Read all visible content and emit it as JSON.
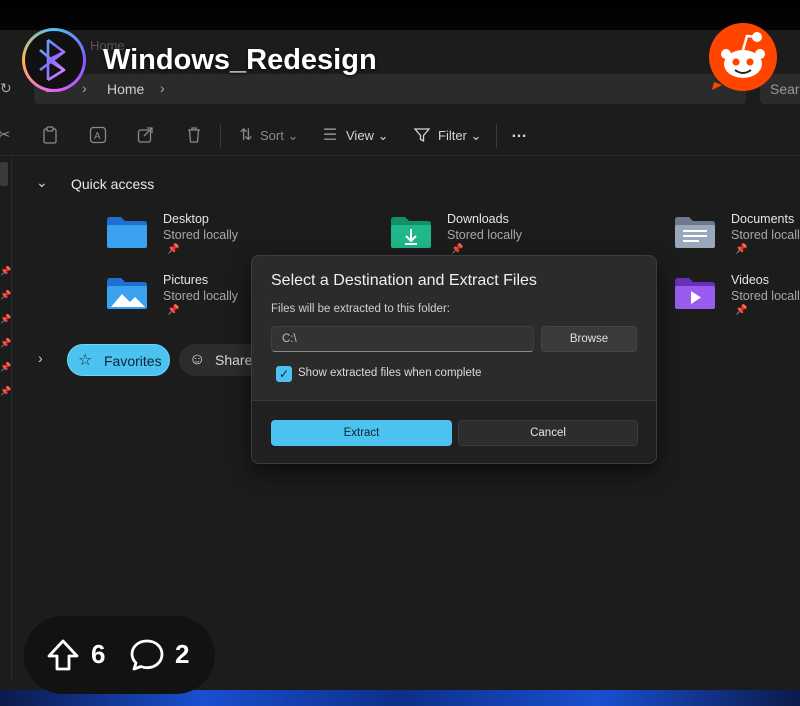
{
  "post": {
    "subreddit": "Windows_Redesign",
    "upvotes": "6",
    "comments": "2"
  },
  "explorer": {
    "ghost_tab": "Home",
    "address": {
      "location": "Home",
      "search_placeholder": "Search"
    },
    "toolbar": {
      "sort_label": "Sort",
      "view_label": "View",
      "filter_label": "Filter",
      "more_label": "…"
    },
    "quick_access": {
      "title": "Quick access",
      "folders": [
        {
          "name": "Desktop",
          "status": "Stored locally",
          "icon": "desktop-folder-icon"
        },
        {
          "name": "Downloads",
          "status": "Stored locally",
          "icon": "downloads-folder-icon"
        },
        {
          "name": "Documents",
          "status": "Stored locally",
          "icon": "documents-folder-icon"
        },
        {
          "name": "Pictures",
          "status": "Stored locally",
          "icon": "pictures-folder-icon"
        },
        {
          "name": "Videos",
          "status": "Stored locally",
          "icon": "videos-folder-icon"
        }
      ]
    },
    "tags": {
      "favorites": "Favorites",
      "shared": "Shared"
    }
  },
  "dialog": {
    "title": "Select a Destination and Extract Files",
    "subtitle": "Files will be extracted to this folder:",
    "path_value": "C:\\",
    "browse_label": "Browse",
    "checkbox_label": "Show extracted files when complete",
    "checkbox_checked": true,
    "extract_label": "Extract",
    "cancel_label": "Cancel"
  },
  "colors": {
    "accent": "#4cc2f1",
    "reddit_orange": "#ff4500",
    "window_bg": "#1c1c1c",
    "dialog_bg": "#2b2b2b"
  }
}
